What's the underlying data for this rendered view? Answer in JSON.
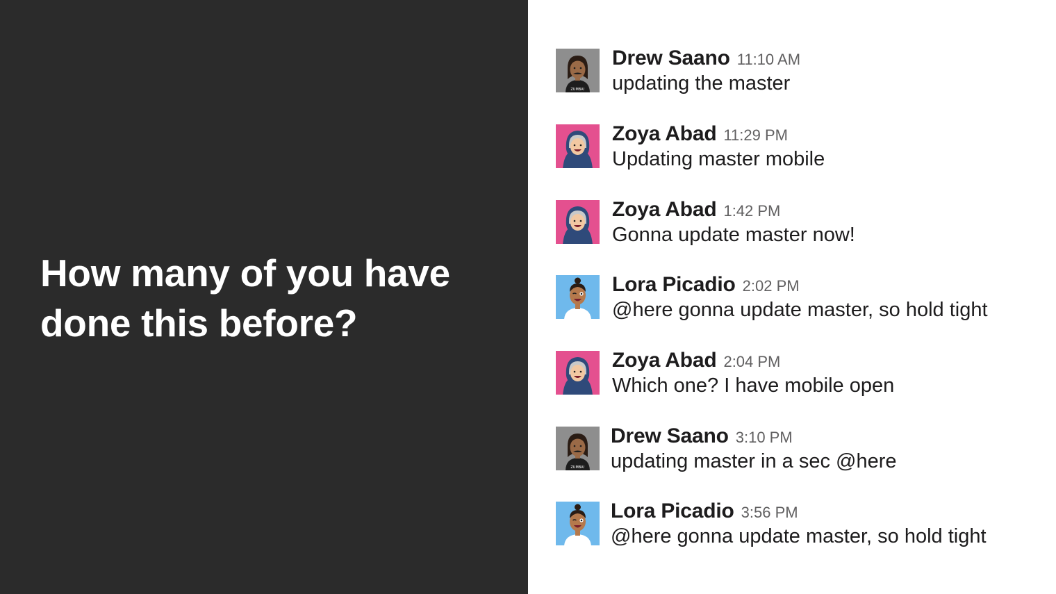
{
  "headline": {
    "line1": "How many of you have",
    "line2": "done this before?"
  },
  "colors": {
    "left_bg": "#2b2b2b",
    "headline_text": "#ffffff",
    "right_bg": "#ffffff",
    "author_text": "#1d1c1d",
    "time_text": "#616061",
    "body_text": "#1d1c1d"
  },
  "avatar_styles": {
    "drew": {
      "bg": "#8e8e8e",
      "skin": "#9a6a47",
      "hair": "#2a1c14",
      "shirt": "#1d1d1d",
      "shirt_text": "ZUMBA!"
    },
    "zoya": {
      "bg": "#e4508f",
      "skin": "#f2c8a2",
      "hijab": "#2f4a7a",
      "hijab_inner": "#c9c9c9"
    },
    "lora": {
      "bg": "#6fb9ec",
      "skin": "#b5794c",
      "hair": "#2a1c14",
      "shirt": "#ffffff"
    }
  },
  "messages": [
    {
      "author": "Drew Saano",
      "time": "11:10 AM",
      "text": "updating the master",
      "avatar": "drew-avatar"
    },
    {
      "author": "Zoya Abad",
      "time": "11:29 PM",
      "text": "Updating master mobile",
      "avatar": "zoya-avatar"
    },
    {
      "author": "Zoya Abad",
      "time": "1:42 PM",
      "text": "Gonna update master now!",
      "avatar": "zoya-avatar"
    },
    {
      "author": "Lora Picadio",
      "time": "2:02 PM",
      "text": "@here gonna update master, so hold tight",
      "avatar": "lora-avatar"
    },
    {
      "author": "Zoya Abad",
      "time": "2:04 PM",
      "text": "Which one? I have mobile open",
      "avatar": "zoya-avatar"
    },
    {
      "author": "Drew Saano",
      "time": "3:10 PM",
      "text": "updating master in a sec @here",
      "avatar": "drew-avatar"
    },
    {
      "author": "Lora Picadio",
      "time": "3:56 PM",
      "text": "@here gonna update master, so hold tight",
      "avatar": "lora-avatar"
    }
  ]
}
